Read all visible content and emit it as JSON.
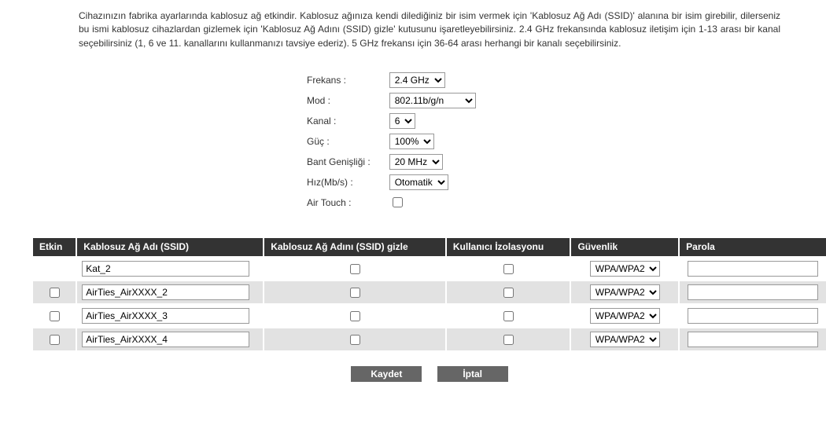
{
  "description": "Cihazınızın fabrika ayarlarında kablosuz ağ etkindir. Kablosuz ağınıza kendi dilediğiniz bir isim vermek için 'Kablosuz Ağ Adı (SSID)' alanına bir isim girebilir, dilerseniz bu ismi kablosuz cihazlardan gizlemek için 'Kablosuz Ağ Adını (SSID) gizle' kutusunu işaretleyebilirsiniz. 2.4 GHz frekansında kablosuz iletişim için 1-13 arası bir kanal seçebilirsiniz (1, 6 ve 11. kanallarını kullanmanızı tavsiye ederiz). 5 GHz frekansı için 36-64 arası herhangi bir kanalı seçebilirsiniz.",
  "settings": {
    "frequency": {
      "label": "Frekans :",
      "value": "2.4 GHz"
    },
    "mode": {
      "label": "Mod :",
      "value": "802.11b/g/n"
    },
    "channel": {
      "label": "Kanal :",
      "value": "6"
    },
    "power": {
      "label": "Güç :",
      "value": "100%"
    },
    "bandwidth": {
      "label": "Bant Genişliği :",
      "value": "20 MHz"
    },
    "speed": {
      "label": "Hız(Mb/s) :",
      "value": "Otomatik"
    },
    "airtouch": {
      "label": "Air Touch :",
      "checked": false
    }
  },
  "table": {
    "headers": {
      "enabled": "Etkin",
      "ssid": "Kablosuz Ağ Adı (SSID)",
      "hide": "Kablosuz Ağ Adını (SSID) gizle",
      "isolation": "Kullanıcı İzolasyonu",
      "security": "Güvenlik",
      "password": "Parola"
    },
    "rows": [
      {
        "enabled": null,
        "ssid": "Kat_2",
        "hide": false,
        "isolation": false,
        "security": "WPA/WPA2",
        "password": ""
      },
      {
        "enabled": false,
        "ssid": "AirTies_AirXXXX_2",
        "hide": false,
        "isolation": false,
        "security": "WPA/WPA2",
        "password": ""
      },
      {
        "enabled": false,
        "ssid": "AirTies_AirXXXX_3",
        "hide": false,
        "isolation": false,
        "security": "WPA/WPA2",
        "password": ""
      },
      {
        "enabled": false,
        "ssid": "AirTies_AirXXXX_4",
        "hide": false,
        "isolation": false,
        "security": "WPA/WPA2",
        "password": ""
      }
    ]
  },
  "buttons": {
    "save": "Kaydet",
    "cancel": "İptal"
  }
}
